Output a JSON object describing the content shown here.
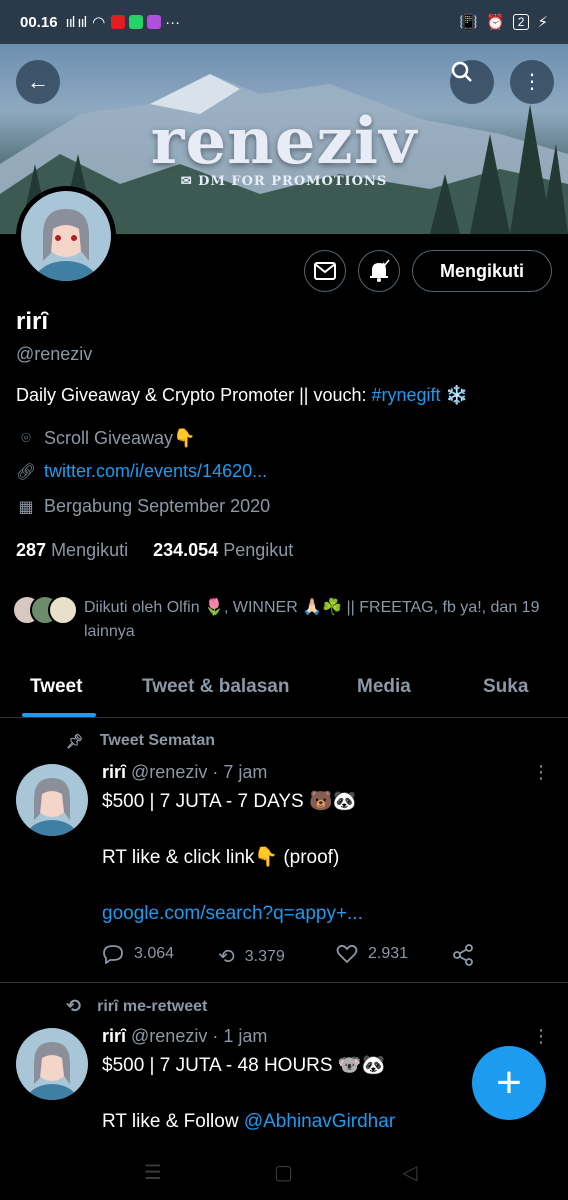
{
  "status_bar": {
    "time": "00.16",
    "signal": "ııl ııl",
    "battery": "2"
  },
  "banner": {
    "brand": "reneziv",
    "tagline": "✉ DM FOR PROMOTIONS"
  },
  "profile": {
    "follow_label": "Mengikuti",
    "name": "rirȋ",
    "handle": "@reneziv",
    "bio_text": "Daily Giveaway & Crypto Promoter || vouch: ",
    "bio_hashtag": "#rynegift",
    "bio_emoji": "❄️",
    "location": "Scroll Giveaway👇",
    "website": "twitter.com/i/events/14620...",
    "joined": "Bergabung September 2020",
    "following_count": "287",
    "following_label": "Mengikuti",
    "followers_count": "234.054",
    "followers_label": "Pengikut",
    "followed_by": "Diikuti oleh Olfin 🌷, WINNER 🙏🏻☘️ || FREETAG, fb ya!, dan 19 lainnya"
  },
  "tabs": [
    "Tweet",
    "Tweet & balasan",
    "Media",
    "Suka"
  ],
  "tweets": [
    {
      "context": "Tweet Sematan",
      "name": "rirȋ",
      "handle": "@reneziv",
      "time": "· 7 jam",
      "line1": "$500 | 7 JUTA - 7 DAYS 🐻🐼",
      "line2": "RT like & click link👇  (proof)",
      "link": "google.com/search?q=appy+...",
      "replies": "3.064",
      "retweets": "3.379",
      "likes": "2.931"
    },
    {
      "context": "rirȋ me-retweet",
      "name": "rirȋ",
      "handle": "@reneziv",
      "time": "· 1 jam",
      "line1": "$500 | 7 JUTA - 48 HOURS 🐨🐼",
      "line2_text": "RT like & Follow ",
      "line2_mention": "@AbhinavGirdhar"
    }
  ],
  "fab": "+",
  "colors": {
    "accent": "#1d9bf0",
    "background": "#000000",
    "muted": "#8b98a5"
  }
}
